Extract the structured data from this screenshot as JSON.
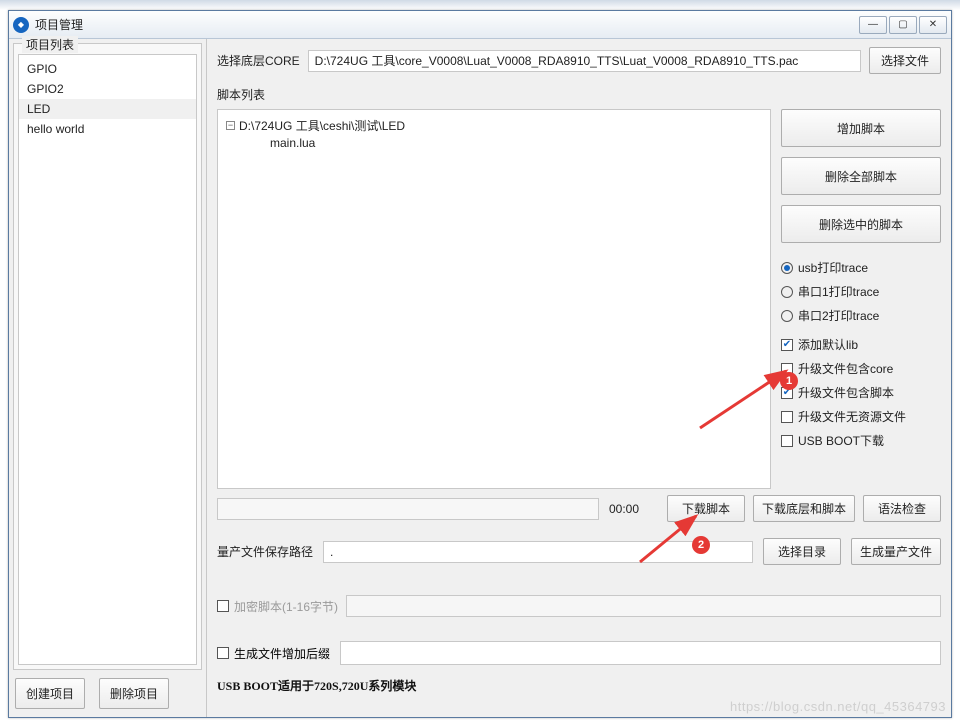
{
  "window": {
    "title": "项目管理",
    "controls": {
      "min": "—",
      "max": "▢",
      "close": "✕"
    }
  },
  "left": {
    "legend": "项目列表",
    "items": [
      "GPIO",
      "GPIO2",
      "LED",
      "hello world"
    ],
    "selected_index": 2,
    "create_btn": "创建项目",
    "delete_btn": "删除项目"
  },
  "core": {
    "label": "选择底层CORE",
    "path": "D:\\724UG 工具\\core_V0008\\Luat_V0008_RDA8910_TTS\\Luat_V0008_RDA8910_TTS.pac",
    "choose_btn": "选择文件"
  },
  "scripts": {
    "label": "脚本列表",
    "root": "D:\\724UG 工具\\ceshi\\测试\\LED",
    "children": [
      "main.lua"
    ],
    "add_btn": "增加脚本",
    "del_all_btn": "删除全部脚本",
    "del_sel_btn": "删除选中的脚本",
    "options": {
      "radio": [
        {
          "label": "usb打印trace",
          "checked": true
        },
        {
          "label": "串口1打印trace",
          "checked": false
        },
        {
          "label": "串口2打印trace",
          "checked": false
        }
      ],
      "check": [
        {
          "label": "添加默认lib",
          "checked": true
        },
        {
          "label": "升级文件包含core",
          "checked": false
        },
        {
          "label": "升级文件包含脚本",
          "checked": true
        },
        {
          "label": "升级文件无资源文件",
          "checked": false
        },
        {
          "label": "USB BOOT下载",
          "checked": false
        }
      ]
    }
  },
  "progress": {
    "time": "00:00",
    "download_script_btn": "下载脚本",
    "download_core_script_btn": "下载底层和脚本",
    "syntax_btn": "语法检查"
  },
  "masspath": {
    "label": "量产文件保存路径",
    "value": ".",
    "choose_dir_btn": "选择目录",
    "gen_btn": "生成量产文件"
  },
  "encrypt": {
    "label": "加密脚本(1-16字节)",
    "checked": false,
    "value": ""
  },
  "suffix": {
    "label": "生成文件增加后缀",
    "checked": false
  },
  "note": "USB BOOT适用于720S,720U系列模块",
  "annotations": {
    "badge1": "1",
    "badge2": "2"
  },
  "watermark": "https://blog.csdn.net/qq_45364793"
}
